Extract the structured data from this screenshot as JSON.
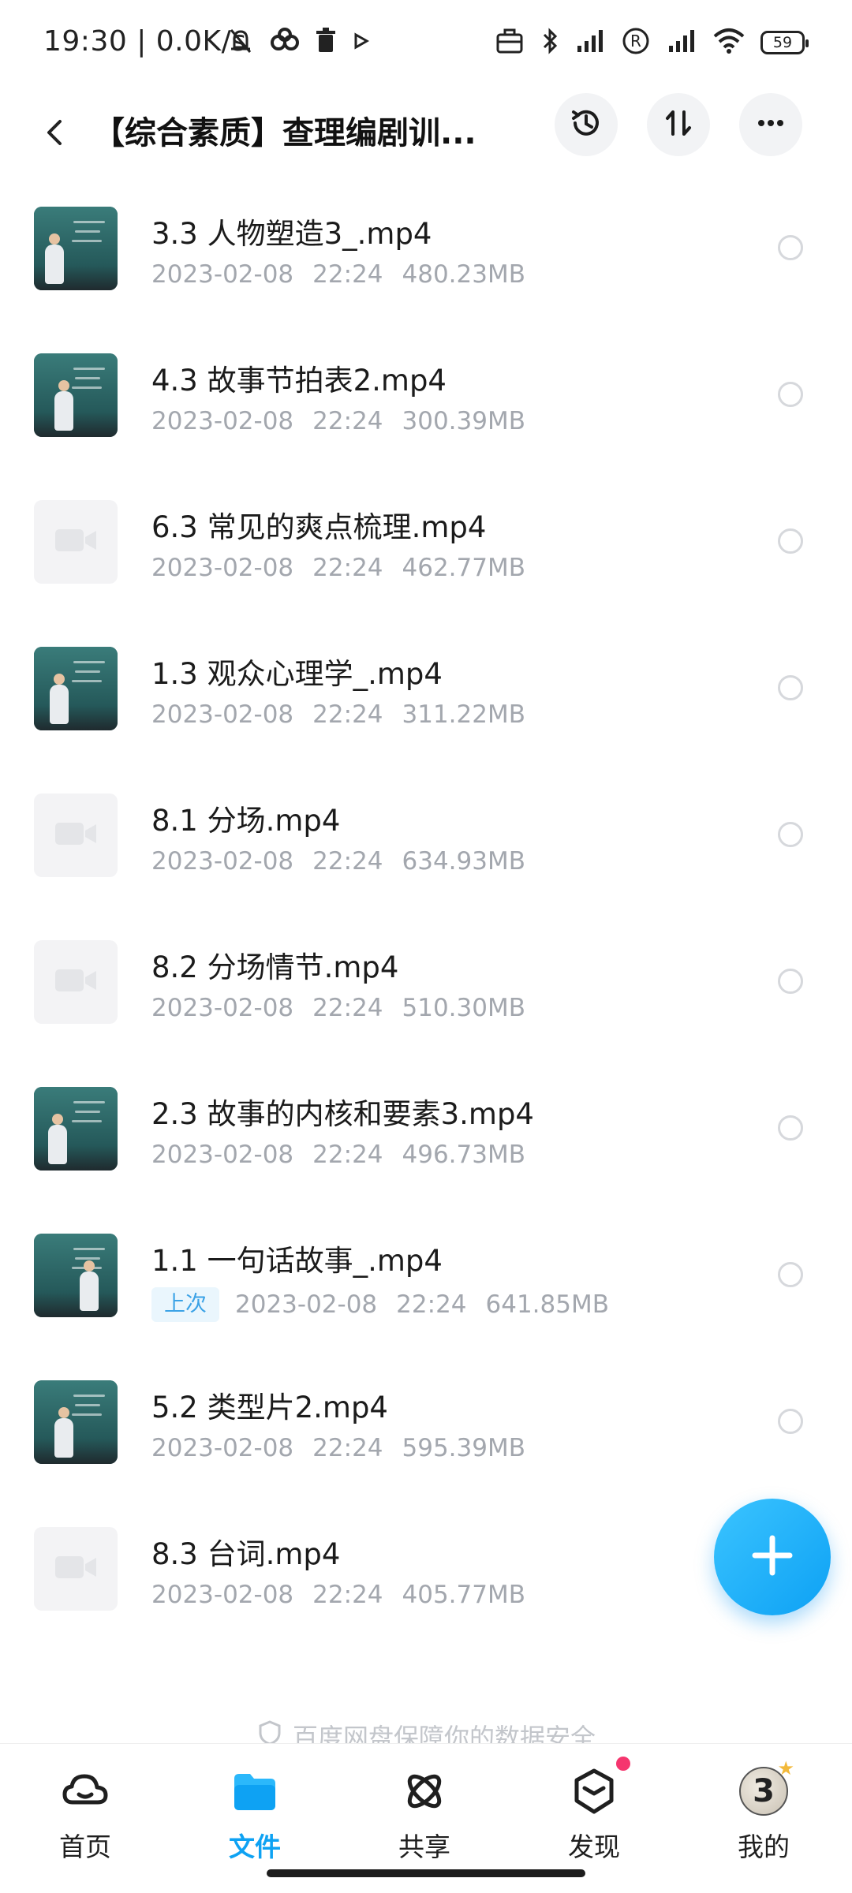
{
  "status_bar": {
    "time": "19:30 | 0.0K/s",
    "battery": "59",
    "left_icons": [
      "mute-icon",
      "baidu-cloud-icon",
      "trash-icon",
      "play-icon"
    ],
    "right_icons": [
      "briefcase-icon",
      "bluetooth-icon",
      "signal-icon",
      "registered-icon",
      "signal-icon",
      "wifi-icon"
    ]
  },
  "header": {
    "title": "【综合素质】查理编剧训...",
    "back_icon": "chevron-left-icon",
    "history_icon": "history-icon",
    "sort_icon": "sort-icon",
    "more_icon": "more-icon"
  },
  "files": [
    {
      "name": "3.3 人物塑造3_.mp4",
      "date": "2023-02-08",
      "time": "22:24",
      "size": "480.23MB",
      "thumb": "video",
      "badge": ""
    },
    {
      "name": "4.3 故事节拍表2.mp4",
      "date": "2023-02-08",
      "time": "22:24",
      "size": "300.39MB",
      "thumb": "video",
      "badge": ""
    },
    {
      "name": "6.3 常见的爽点梳理.mp4",
      "date": "2023-02-08",
      "time": "22:24",
      "size": "462.77MB",
      "thumb": "placeholder",
      "badge": ""
    },
    {
      "name": "1.3 观众心理学_.mp4",
      "date": "2023-02-08",
      "time": "22:24",
      "size": "311.22MB",
      "thumb": "video",
      "badge": ""
    },
    {
      "name": "8.1 分场.mp4",
      "date": "2023-02-08",
      "time": "22:24",
      "size": "634.93MB",
      "thumb": "placeholder",
      "badge": ""
    },
    {
      "name": "8.2 分场情节.mp4",
      "date": "2023-02-08",
      "time": "22:24",
      "size": "510.30MB",
      "thumb": "placeholder",
      "badge": ""
    },
    {
      "name": "2.3 故事的内核和要素3.mp4",
      "date": "2023-02-08",
      "time": "22:24",
      "size": "496.73MB",
      "thumb": "video",
      "badge": ""
    },
    {
      "name": "1.1 一句话故事_.mp4",
      "date": "2023-02-08",
      "time": "22:24",
      "size": "641.85MB",
      "thumb": "video",
      "badge": "上次"
    },
    {
      "name": "5.2 类型片2.mp4",
      "date": "2023-02-08",
      "time": "22:24",
      "size": "595.39MB",
      "thumb": "video",
      "badge": ""
    },
    {
      "name": "8.3 台词.mp4",
      "date": "2023-02-08",
      "time": "22:24",
      "size": "405.77MB",
      "thumb": "placeholder",
      "badge": ""
    }
  ],
  "footer_note": "百度网盘保障你的数据安全",
  "fab_icon": "plus-icon",
  "bottom_nav": [
    {
      "label": "首页",
      "icon": "cloud-icon",
      "active": false
    },
    {
      "label": "文件",
      "icon": "folder-icon",
      "active": true
    },
    {
      "label": "共享",
      "icon": "atom-icon",
      "active": false
    },
    {
      "label": "发现",
      "icon": "cube-icon",
      "active": false,
      "dot": true
    },
    {
      "label": "我的",
      "icon": "avatar-icon",
      "active": false
    }
  ],
  "colors": {
    "accent": "#0ea2f3",
    "meta_text": "#a3a7ae",
    "badge_bg": "#eaf6fd",
    "badge_text": "#3ba2e6",
    "notification_dot": "#f5366e"
  }
}
